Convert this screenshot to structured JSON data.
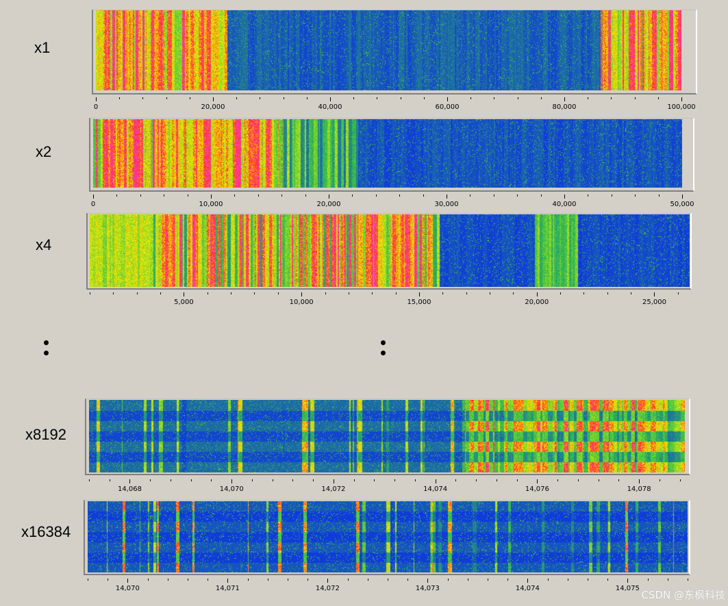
{
  "watermark": "CSDN @东枫科技",
  "ellipsis": ":",
  "colors": {
    "background": "#d4d0c8",
    "low": "#0a28f0",
    "mid": "#33c04a",
    "high": "#f5f000",
    "peak": "#ff2a2a",
    "max": "#ff3ad0"
  },
  "chart_data": [
    {
      "type": "heatmap",
      "label": "x1",
      "xlim": [
        0,
        100000
      ],
      "ticks": [
        0,
        20000,
        40000,
        60000,
        80000,
        100000
      ],
      "tick_labels": [
        "0",
        "20,000",
        "40,000",
        "60,000",
        "80,000",
        "100,000"
      ]
    },
    {
      "type": "heatmap",
      "label": "x2",
      "xlim": [
        0,
        50000
      ],
      "ticks": [
        0,
        10000,
        20000,
        30000,
        40000,
        50000
      ],
      "tick_labels": [
        "0",
        "10,000",
        "20,000",
        "30,000",
        "40,000",
        "50,000"
      ]
    },
    {
      "type": "heatmap",
      "label": "x4",
      "xlim": [
        1000,
        26500
      ],
      "ticks": [
        5000,
        10000,
        15000,
        20000,
        25000
      ],
      "tick_labels": [
        "5,000",
        "10,000",
        "15,000",
        "20,000",
        "25,000"
      ]
    },
    {
      "type": "heatmap",
      "label": "x8192",
      "xlim": [
        14067.2,
        14078.9
      ],
      "ticks": [
        14068,
        14070,
        14072,
        14074,
        14076,
        14078
      ],
      "tick_labels": [
        "14,068",
        "14,070",
        "14,072",
        "14,074",
        "14,076",
        "14,078"
      ]
    },
    {
      "type": "heatmap",
      "label": "x16384",
      "xlim": [
        14069.6,
        14075.6
      ],
      "ticks": [
        14070,
        14071,
        14072,
        14073,
        14074,
        14075
      ],
      "tick_labels": [
        "14,070",
        "14,071",
        "14,072",
        "14,073",
        "14,074",
        "14,075"
      ]
    }
  ]
}
